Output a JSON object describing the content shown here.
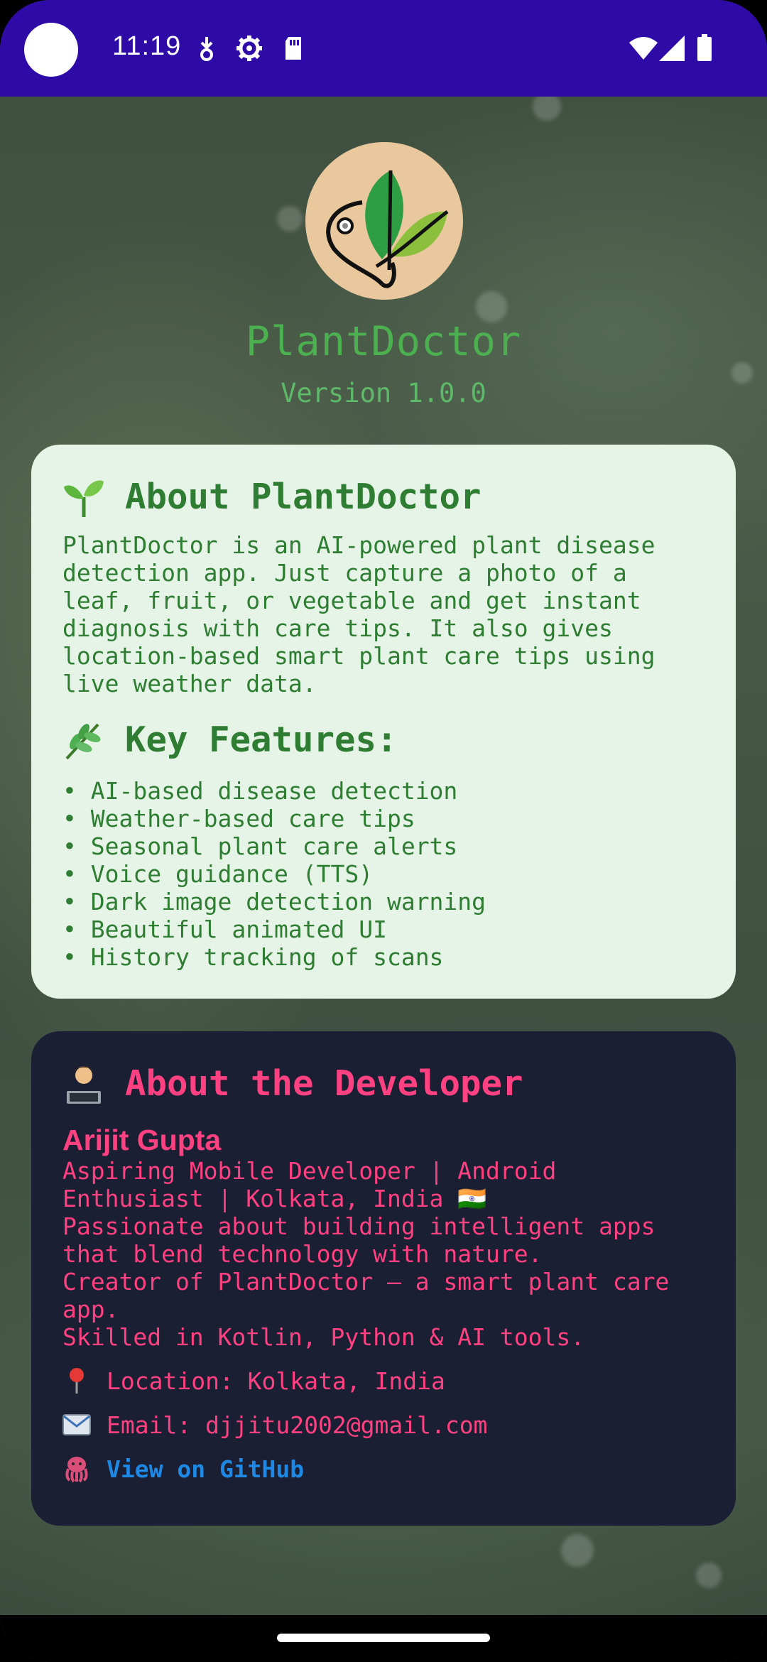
{
  "status_bar": {
    "time": "11:19",
    "left_icons": [
      "data-saver-icon",
      "settings-icon",
      "sd-card-icon"
    ],
    "right_icons": [
      "wifi-icon",
      "signal-icon",
      "battery-icon"
    ]
  },
  "header": {
    "title": "PlantDoctor",
    "version": "Version 1.0.0"
  },
  "about": {
    "heading_emoji": "seedling-icon",
    "heading": "About PlantDoctor",
    "body": "PlantDoctor is an AI-powered plant disease\ndetection app. Just capture a photo of a\nleaf, fruit, or vegetable and get instant\ndiagnosis with care tips. It also gives\nlocation-based smart plant care tips using\nlive weather data.",
    "features_emoji": "herb-icon",
    "features_heading": "Key Features:",
    "features": [
      "• AI-based disease detection",
      "• Weather-based care tips",
      "• Seasonal plant care alerts",
      "• Voice guidance (TTS)",
      "• Dark image detection warning",
      "• Beautiful animated UI",
      "• History tracking of scans"
    ]
  },
  "developer": {
    "heading_emoji": "technologist-icon",
    "heading": "About the Developer",
    "name": "Arijit Gupta",
    "bio_lines": [
      "Aspiring Mobile Developer | Android",
      "Enthusiast | Kolkata, India 🇮🇳",
      "Passionate about building intelligent apps",
      "that blend technology with nature.",
      "Creator of PlantDoctor – a smart plant care",
      "app.",
      "Skilled in Kotlin, Python & AI tools."
    ],
    "location": "Location: Kolkata, India",
    "email": "Email: djjitu2002@gmail.com",
    "github": "View on GitHub"
  },
  "colors": {
    "status_bar": "#2e0aa6",
    "accent_green": "#4caf50",
    "about_card_bg": "#e5f4e6",
    "dev_card_bg": "#1b1f33",
    "dev_pink": "#ff4081",
    "link_blue": "#1e88e5"
  }
}
